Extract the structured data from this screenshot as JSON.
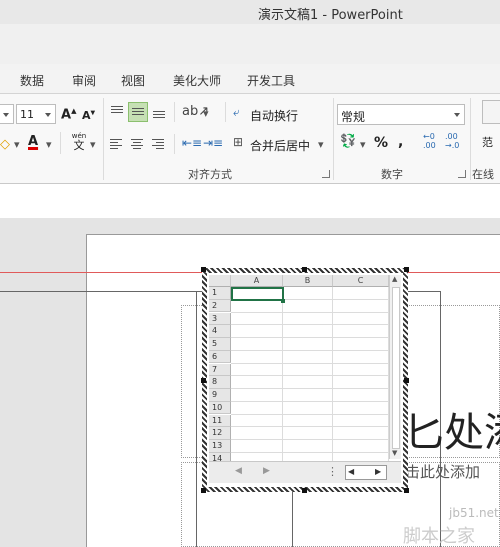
{
  "window": {
    "title": "演示文稿1 - PowerPoint"
  },
  "tabs": [
    "数据",
    "审阅",
    "视图",
    "美化大师",
    "开发工具"
  ],
  "font": {
    "size": "11"
  },
  "alignment": {
    "wrap_text": "自动换行",
    "merge_center": "合并后居中",
    "group_label": "对齐方式"
  },
  "number": {
    "format": "常规",
    "percent": "%",
    "comma": ",",
    "inc_decimal_top": "←0",
    "inc_decimal_bottom": ".00",
    "dec_decimal_top": ".00",
    "dec_decimal_bottom": "→.0",
    "group_label": "数字"
  },
  "styles": {
    "partial_label": "范",
    "group_partial": "在线"
  },
  "phonetic": {
    "top": "wén",
    "bottom": "文"
  },
  "sheet": {
    "columns": [
      "A",
      "B",
      "C"
    ],
    "rows": [
      "1",
      "2",
      "3",
      "4",
      "5",
      "6",
      "7",
      "8",
      "9",
      "10",
      "11",
      "12",
      "13",
      "14"
    ]
  },
  "slide": {
    "title_partial": "匕处添",
    "subtitle_partial": "击此处添加"
  },
  "watermark": {
    "line1": "jb51.net",
    "line2": "脚本之家"
  },
  "colors": {
    "accent": "#217346",
    "selected_fill": "#c6e0b4",
    "guide_line": "#e05a5a"
  }
}
